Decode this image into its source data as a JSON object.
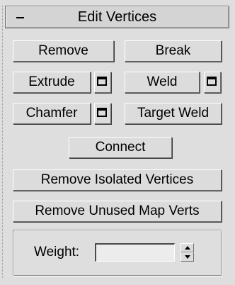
{
  "rollout": {
    "title": "Edit Vertices",
    "collapse_symbol": "-"
  },
  "buttons": {
    "remove": "Remove",
    "break": "Break",
    "extrude": "Extrude",
    "weld": "Weld",
    "chamfer": "Chamfer",
    "target_weld": "Target Weld",
    "connect": "Connect",
    "remove_isolated": "Remove Isolated Vertices",
    "remove_unused": "Remove Unused Map Verts"
  },
  "icons": {
    "settings": "settings-window-icon",
    "spinner_up": "spinner-up-arrow-icon",
    "spinner_down": "spinner-down-arrow-icon"
  },
  "weight": {
    "label": "Weight:",
    "value": "",
    "placeholder": ""
  },
  "colors": {
    "panel_bg": "#dedede",
    "button_bg": "#dcdcdc",
    "input_bg": "#ececec"
  }
}
